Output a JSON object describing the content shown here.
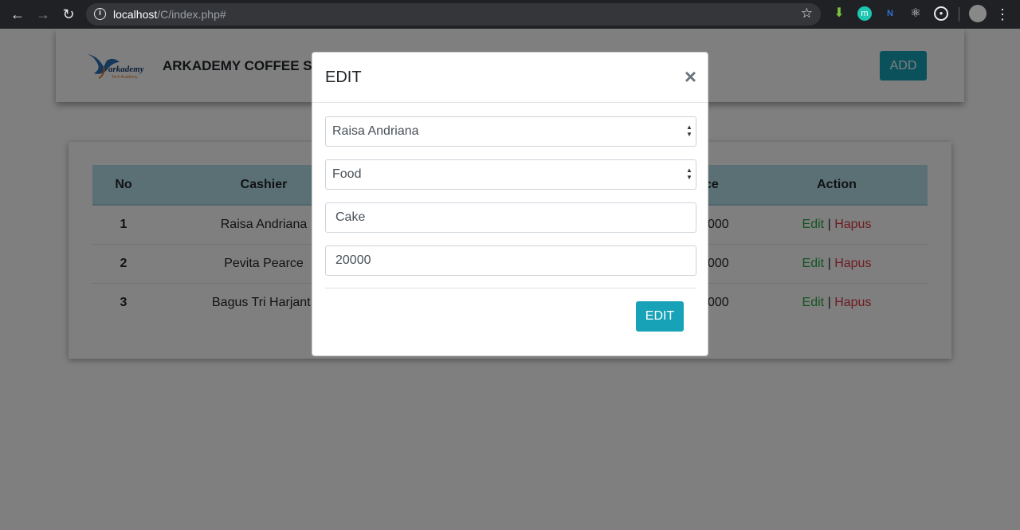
{
  "browser": {
    "url_host": "localhost",
    "url_path": "/C/index.php#"
  },
  "navbar": {
    "logo_text": "arkademy",
    "logo_subtext": "Tech Academy",
    "title": "ARKADEMY COFFEE S",
    "add_label": "ADD"
  },
  "table": {
    "headers": [
      "No",
      "Cashier",
      "ce",
      "Action"
    ],
    "rows": [
      {
        "no": "1",
        "cashier": "Raisa Andriana",
        "price": "000",
        "edit": "Edit",
        "sep": "|",
        "delete": "Hapus"
      },
      {
        "no": "2",
        "cashier": "Pevita Pearce",
        "price": "000",
        "edit": "Edit",
        "sep": "|",
        "delete": "Hapus"
      },
      {
        "no": "3",
        "cashier": "Bagus Tri Harjant",
        "price": "000",
        "edit": "Edit",
        "sep": "|",
        "delete": "Hapus"
      }
    ]
  },
  "modal": {
    "title": "EDIT",
    "close": "×",
    "cashier_value": "Raisa Andriana",
    "category_value": "Food",
    "name_value": "Cake",
    "price_value": "20000",
    "submit_label": "EDIT"
  },
  "colors": {
    "accent": "#17a2b8",
    "edit_link": "#28a745",
    "delete_link": "#dc3545",
    "table_header": "#b5e1e8"
  }
}
